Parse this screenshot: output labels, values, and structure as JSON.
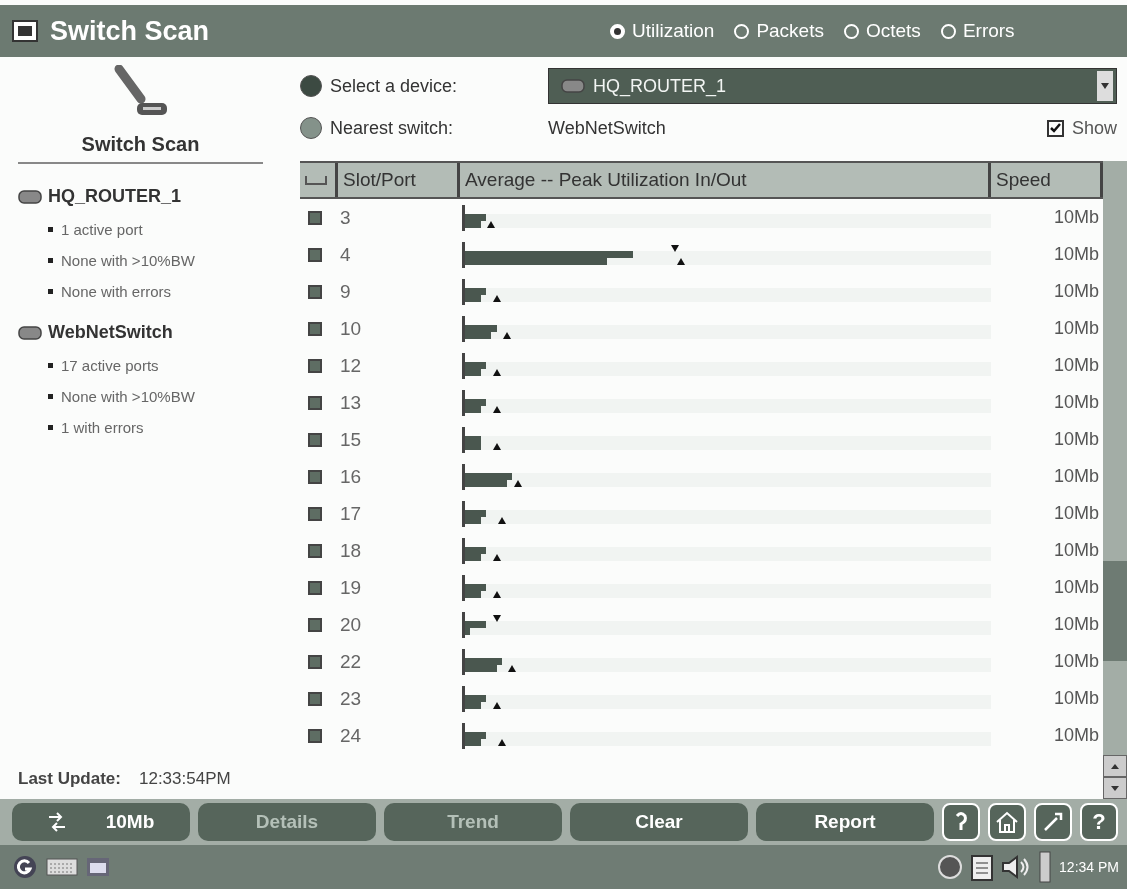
{
  "window": {
    "title": "Switch Scan"
  },
  "views": [
    {
      "label": "Utilization",
      "selected": true
    },
    {
      "label": "Packets",
      "selected": false
    },
    {
      "label": "Octets",
      "selected": false
    },
    {
      "label": "Errors",
      "selected": false
    }
  ],
  "sidebar": {
    "title": "Switch Scan",
    "devices": [
      {
        "name": "HQ_ROUTER_1",
        "facts": [
          "1 active port",
          "None with >10%BW",
          "None with errors"
        ]
      },
      {
        "name": "WebNetSwitch",
        "facts": [
          "17 active ports",
          "None with >10%BW",
          "1 with errors"
        ]
      }
    ],
    "last_update": {
      "label": "Last Update:",
      "value": "12:33:54PM"
    }
  },
  "device_select": {
    "label": "Select a device:",
    "value": "HQ_ROUTER_1",
    "color": "#3c4a42"
  },
  "nearest_switch": {
    "label": "Nearest switch:",
    "value": "WebNetSwitch",
    "color": "#84928a"
  },
  "show": {
    "label": "Show",
    "checked": true
  },
  "table": {
    "columns": [
      "Slot/Port",
      "Average -- Peak Utilization In/Out",
      "Speed"
    ],
    "rows": [
      {
        "port": "3",
        "speed": "10Mb",
        "bars": [
          {
            "level": 0.04
          },
          {
            "level": 0.03
          }
        ],
        "peaks": [
          {
            "kind": "up",
            "level": 0.05
          }
        ]
      },
      {
        "port": "4",
        "speed": "10Mb",
        "bars": [
          {
            "level": 0.32
          },
          {
            "level": 0.27
          }
        ],
        "peaks": [
          {
            "kind": "down",
            "level": 0.4
          },
          {
            "kind": "up",
            "level": 0.41
          }
        ]
      },
      {
        "port": "9",
        "speed": "10Mb",
        "bars": [
          {
            "level": 0.04
          },
          {
            "level": 0.03
          }
        ],
        "peaks": [
          {
            "kind": "up",
            "level": 0.06
          }
        ]
      },
      {
        "port": "10",
        "speed": "10Mb",
        "bars": [
          {
            "level": 0.06
          },
          {
            "level": 0.05
          }
        ],
        "peaks": [
          {
            "kind": "up",
            "level": 0.08
          }
        ]
      },
      {
        "port": "12",
        "speed": "10Mb",
        "bars": [
          {
            "level": 0.04
          },
          {
            "level": 0.03
          }
        ],
        "peaks": [
          {
            "kind": "up",
            "level": 0.06
          }
        ]
      },
      {
        "port": "13",
        "speed": "10Mb",
        "bars": [
          {
            "level": 0.04
          },
          {
            "level": 0.03
          }
        ],
        "peaks": [
          {
            "kind": "up",
            "level": 0.06
          }
        ]
      },
      {
        "port": "15",
        "speed": "10Mb",
        "bars": [
          {
            "level": 0.03
          },
          {
            "level": 0.03
          }
        ],
        "peaks": [
          {
            "kind": "up",
            "level": 0.06
          }
        ]
      },
      {
        "port": "16",
        "speed": "10Mb",
        "bars": [
          {
            "level": 0.09
          },
          {
            "level": 0.08
          }
        ],
        "peaks": [
          {
            "kind": "up",
            "level": 0.1
          }
        ]
      },
      {
        "port": "17",
        "speed": "10Mb",
        "bars": [
          {
            "level": 0.04
          },
          {
            "level": 0.03
          }
        ],
        "peaks": [
          {
            "kind": "up",
            "level": 0.07
          }
        ]
      },
      {
        "port": "18",
        "speed": "10Mb",
        "bars": [
          {
            "level": 0.04
          },
          {
            "level": 0.03
          }
        ],
        "peaks": [
          {
            "kind": "up",
            "level": 0.06
          }
        ]
      },
      {
        "port": "19",
        "speed": "10Mb",
        "bars": [
          {
            "level": 0.04
          },
          {
            "level": 0.03
          }
        ],
        "peaks": [
          {
            "kind": "up",
            "level": 0.06
          }
        ]
      },
      {
        "port": "20",
        "speed": "10Mb",
        "bars": [
          {
            "level": 0.04
          },
          {
            "level": 0.01
          }
        ],
        "peaks": [
          {
            "kind": "down",
            "level": 0.06
          }
        ]
      },
      {
        "port": "22",
        "speed": "10Mb",
        "bars": [
          {
            "level": 0.07
          },
          {
            "level": 0.06
          }
        ],
        "peaks": [
          {
            "kind": "up",
            "level": 0.09
          }
        ]
      },
      {
        "port": "23",
        "speed": "10Mb",
        "bars": [
          {
            "level": 0.04
          },
          {
            "level": 0.03
          }
        ],
        "peaks": [
          {
            "kind": "up",
            "level": 0.06
          }
        ]
      },
      {
        "port": "24",
        "speed": "10Mb",
        "bars": [
          {
            "level": 0.04
          },
          {
            "level": 0.03
          }
        ],
        "peaks": [
          {
            "kind": "up",
            "level": 0.07
          }
        ]
      }
    ]
  },
  "toolbar": {
    "buttons": [
      {
        "label": "10Mb",
        "disabled": false,
        "kind": "speed"
      },
      {
        "label": "Details",
        "disabled": true
      },
      {
        "label": "Trend",
        "disabled": true
      },
      {
        "label": "Clear",
        "disabled": false
      },
      {
        "label": "Report",
        "disabled": false
      }
    ],
    "help": "?"
  },
  "taskbar": {
    "clock": "12:34 PM"
  }
}
